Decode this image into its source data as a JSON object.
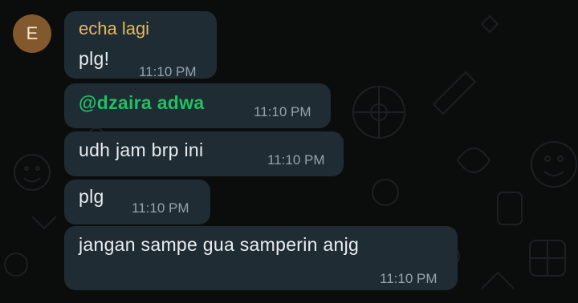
{
  "chat": {
    "avatar_letter": "E",
    "messages": [
      {
        "sender": "echa lagi",
        "text": "plg!",
        "time": "11:10 PM"
      },
      {
        "text": "@dzaira adwa",
        "time": "11:10 PM",
        "mention": true
      },
      {
        "text": "udh jam brp ini",
        "time": "11:10 PM"
      },
      {
        "text": "plg",
        "time": "11:10 PM"
      },
      {
        "text": "jangan sampe gua samperin anjg",
        "time": "11:10 PM"
      }
    ]
  },
  "colors": {
    "background": "#0b0d0d",
    "bubble": "#1f2c34",
    "sender_name": "#e3b95f",
    "mention": "#21c063",
    "avatar": "#81592c"
  }
}
